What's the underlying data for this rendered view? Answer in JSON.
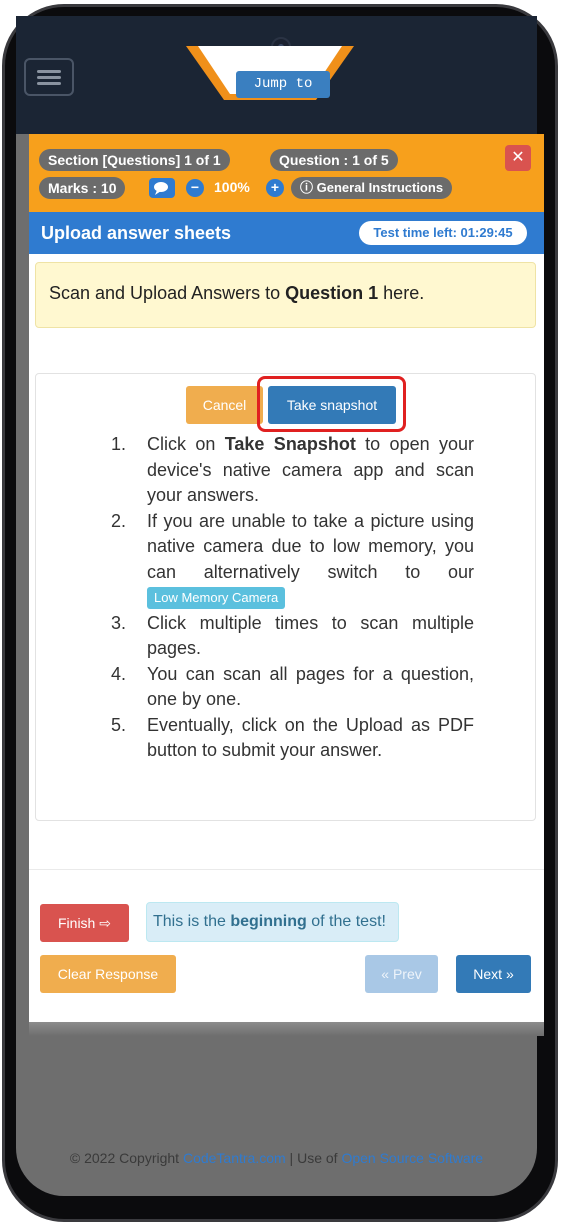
{
  "nav": {
    "jump_label": "Jump to"
  },
  "info": {
    "section": "Section [Questions] 1 of 1",
    "question": "Question : 1 of 5",
    "marks": "Marks : 10",
    "zoom": "100%",
    "instructions_link": "General Instructions"
  },
  "header": {
    "title": "Upload answer sheets",
    "timer": "Test time left: 01:29:45"
  },
  "alert": {
    "prefix": "Scan and Upload Answers to ",
    "bold": "Question 1",
    "suffix": " here."
  },
  "actions": {
    "cancel": "Cancel",
    "snapshot": "Take snapshot"
  },
  "steps": {
    "s1_num": "1.",
    "s1_a": "Click on ",
    "s1_b": "Take Snapshot",
    "s1_c": " to open your device's native camera app and scan your answers.",
    "s2_num": "2.",
    "s2_a": "If you are unable to take a picture using native camera due to low memory, you can alternatively switch to our ",
    "s2_btn": "Low Memory Camera",
    "s3_num": "3.",
    "s3": "Click multiple times to scan multiple pages.",
    "s4_num": "4.",
    "s4": "You can scan all pages for a question, one by one.",
    "s5_num": "5.",
    "s5": "Eventually, click on the Upload as PDF button to submit your answer."
  },
  "nav_buttons": {
    "finish": "Finish",
    "note_prefix": "This is the ",
    "note_bold": "beginning",
    "note_suffix": " of the test!",
    "clear": "Clear Response",
    "prev": "« Prev",
    "next": "Next »"
  },
  "footer": {
    "copy": "© 2022 Copyright ",
    "link1": "CodeTantra.com",
    "sep": " | Use of ",
    "link2": "Open Source Software"
  },
  "colors": {
    "orange": "#f7a01c",
    "blue": "#2f7bd0",
    "danger": "#d9534f",
    "warning": "#f0ad4e",
    "primary": "#337ab7"
  }
}
